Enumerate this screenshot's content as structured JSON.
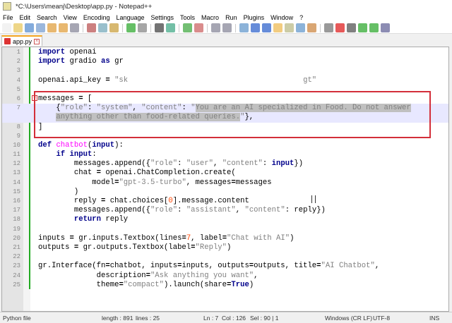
{
  "window": {
    "title": "*C:\\Users\\meanj\\Desktop\\app.py - Notepad++"
  },
  "menu": [
    "File",
    "Edit",
    "Search",
    "View",
    "Encoding",
    "Language",
    "Settings",
    "Tools",
    "Macro",
    "Run",
    "Plugins",
    "Window",
    "?"
  ],
  "tab": {
    "label": "app.py"
  },
  "code": [
    [
      [
        "import",
        "kw"
      ],
      [
        " openai",
        ""
      ]
    ],
    [
      [
        "import",
        "kw"
      ],
      [
        " gradio ",
        ""
      ],
      [
        "as",
        "kw"
      ],
      [
        " gr",
        ""
      ]
    ],
    [],
    [
      [
        "openai.api_key ",
        ""
      ],
      [
        "=",
        "op"
      ],
      [
        " ",
        ""
      ],
      [
        "\"sk                                       gt\"",
        "str"
      ]
    ],
    [],
    [
      [
        "messages ",
        ""
      ],
      [
        "=",
        "op"
      ],
      [
        " [",
        ""
      ]
    ],
    [
      [
        "    {",
        ""
      ],
      [
        "\"role\"",
        "str"
      ],
      [
        ": ",
        ""
      ],
      [
        "\"system\"",
        "str"
      ],
      [
        ", ",
        ""
      ],
      [
        "\"content\"",
        "str"
      ],
      [
        ": ",
        ""
      ],
      [
        "\"",
        "str"
      ],
      [
        "You are an AI specialized in Food. Do not answer",
        "str sel"
      ]
    ],
    [
      [
        "    ",
        ""
      ],
      [
        "anything other than food-related queries.",
        "str sel"
      ],
      [
        "\"",
        "str"
      ],
      [
        "},",
        ""
      ]
    ],
    [
      [
        "]",
        ""
      ]
    ],
    [],
    [
      [
        "def",
        "kw"
      ],
      [
        " ",
        ""
      ],
      [
        "chatbot",
        "fn"
      ],
      [
        "(",
        ""
      ],
      [
        "input",
        "kw"
      ],
      [
        "):",
        ""
      ]
    ],
    [
      [
        "    ",
        ""
      ],
      [
        "if",
        "kw"
      ],
      [
        " ",
        ""
      ],
      [
        "input",
        "kw"
      ],
      [
        ":",
        ""
      ]
    ],
    [
      [
        "        messages.append({",
        ""
      ],
      [
        "\"role\"",
        "str"
      ],
      [
        ": ",
        ""
      ],
      [
        "\"user\"",
        "str"
      ],
      [
        ", ",
        ""
      ],
      [
        "\"content\"",
        "str"
      ],
      [
        ": ",
        ""
      ],
      [
        "input",
        "kw"
      ],
      [
        "})",
        ""
      ]
    ],
    [
      [
        "        chat ",
        ""
      ],
      [
        "=",
        "op"
      ],
      [
        " openai.ChatCompletion.create(",
        ""
      ]
    ],
    [
      [
        "            model",
        ""
      ],
      [
        "=",
        "op"
      ],
      [
        "\"gpt-3.5-turbo\"",
        "str"
      ],
      [
        ", messages",
        ""
      ],
      [
        "=",
        "op"
      ],
      [
        "messages",
        ""
      ]
    ],
    [
      [
        "        )",
        ""
      ]
    ],
    [
      [
        "        reply ",
        ""
      ],
      [
        "=",
        "op"
      ],
      [
        " chat.choices[",
        ""
      ],
      [
        "0",
        "num"
      ],
      [
        "].message.content",
        ""
      ]
    ],
    [
      [
        "        messages.append({",
        ""
      ],
      [
        "\"role\"",
        "str"
      ],
      [
        ": ",
        ""
      ],
      [
        "\"assistant\"",
        "str"
      ],
      [
        ", ",
        ""
      ],
      [
        "\"content\"",
        "str"
      ],
      [
        ": reply})",
        ""
      ]
    ],
    [
      [
        "        ",
        ""
      ],
      [
        "return",
        "kw"
      ],
      [
        " reply",
        ""
      ]
    ],
    [],
    [
      [
        "inputs ",
        ""
      ],
      [
        "=",
        "op"
      ],
      [
        " gr.inputs.Textbox(lines",
        ""
      ],
      [
        "=",
        "op"
      ],
      [
        "7",
        "num"
      ],
      [
        ", label",
        ""
      ],
      [
        "=",
        "op"
      ],
      [
        "\"Chat with AI\"",
        "str"
      ],
      [
        ")",
        ""
      ]
    ],
    [
      [
        "outputs ",
        ""
      ],
      [
        "=",
        "op"
      ],
      [
        " gr.outputs.Textbox(label",
        ""
      ],
      [
        "=",
        "op"
      ],
      [
        "\"Reply\"",
        "str"
      ],
      [
        ")",
        ""
      ]
    ],
    [],
    [
      [
        "gr.Interface(fn",
        ""
      ],
      [
        "=",
        "op"
      ],
      [
        "chatbot, inputs",
        ""
      ],
      [
        "=",
        "op"
      ],
      [
        "inputs, outputs",
        ""
      ],
      [
        "=",
        "op"
      ],
      [
        "outputs, title",
        ""
      ],
      [
        "=",
        "op"
      ],
      [
        "\"AI Chatbot\"",
        "str"
      ],
      [
        ",",
        ""
      ]
    ],
    [
      [
        "             description",
        ""
      ],
      [
        "=",
        "op"
      ],
      [
        "\"Ask anything you want\"",
        "str"
      ],
      [
        ",",
        ""
      ]
    ],
    [
      [
        "             theme",
        ""
      ],
      [
        "=",
        "op"
      ],
      [
        "\"compact\"",
        "str"
      ],
      [
        ").launch(share",
        ""
      ],
      [
        "=",
        "op"
      ],
      [
        "True",
        "kw"
      ],
      [
        ")",
        ""
      ]
    ]
  ],
  "line_numbers": [
    "1",
    "2",
    "3",
    "4",
    "5",
    "6",
    "7",
    "",
    "8",
    "9",
    "10",
    "11",
    "12",
    "13",
    "14",
    "15",
    "16",
    "17",
    "18",
    "19",
    "20",
    "21",
    "22",
    "23",
    "24",
    "25"
  ],
  "status": {
    "type": "Python file",
    "length": "length : 891",
    "lines": "lines : 25",
    "ln": "Ln : 7",
    "col": "Col : 126",
    "sel": "Sel : 90 | 1",
    "eol": "Windows (CR LF)",
    "enc": "UTF-8",
    "mode": "INS"
  }
}
